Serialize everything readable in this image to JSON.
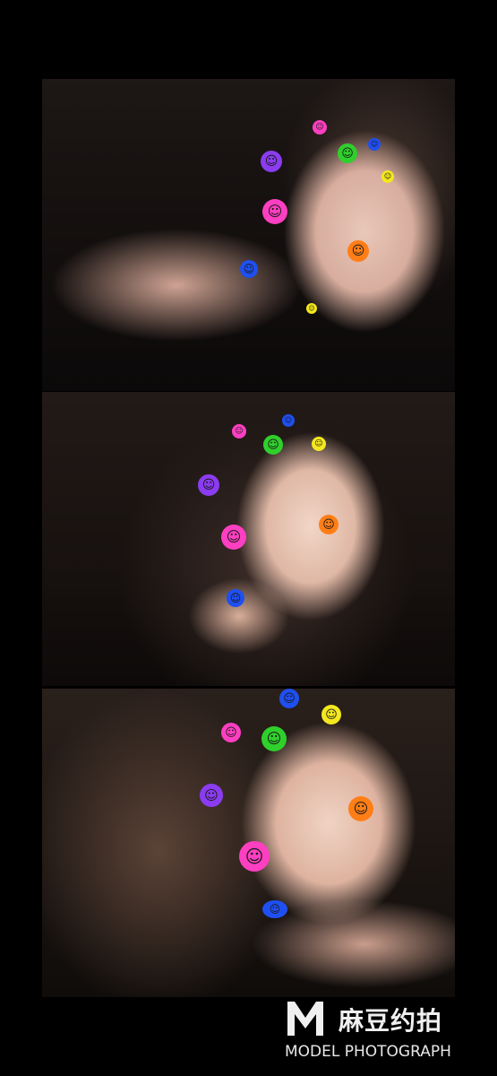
{
  "photos": [
    {
      "stickers": [
        {
          "color": "#ff3fc2"
        },
        {
          "color": "#2fd02b"
        },
        {
          "color": "#1f4ff0"
        },
        {
          "color": "#8b3cf0"
        },
        {
          "color": "#f4e81e"
        },
        {
          "color": "#ff3fc2"
        },
        {
          "color": "#ff7e16"
        },
        {
          "color": "#1f4ff0"
        },
        {
          "color": "#f4e81e"
        }
      ]
    },
    {
      "stickers": [
        {
          "color": "#1f4ff0"
        },
        {
          "color": "#ff3fc2"
        },
        {
          "color": "#2fd02b"
        },
        {
          "color": "#f4e81e"
        },
        {
          "color": "#8b3cf0"
        },
        {
          "color": "#ff3fc2"
        },
        {
          "color": "#ff7e16"
        },
        {
          "color": "#1f4ff0"
        }
      ]
    },
    {
      "stickers": [
        {
          "color": "#1f4ff0"
        },
        {
          "color": "#f4e81e"
        },
        {
          "color": "#ff3fc2"
        },
        {
          "color": "#2fd02b"
        },
        {
          "color": "#8b3cf0"
        },
        {
          "color": "#ff7e16"
        },
        {
          "color": "#ff3fc2"
        },
        {
          "color": "#1f4ff0"
        }
      ]
    }
  ],
  "watermark": {
    "chinese": "麻豆约拍",
    "english": "MODEL PHOTOGRAPH"
  }
}
